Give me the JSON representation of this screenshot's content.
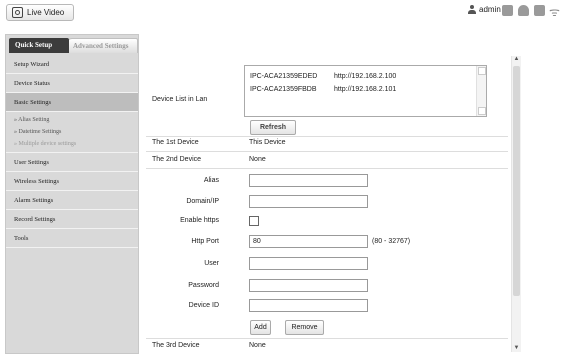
{
  "header": {
    "live_video_label": "Live Video",
    "username": "admin",
    "icons": [
      "person-icon",
      "monitor-icon",
      "headset-icon",
      "speaker-icon",
      "wifi-icon"
    ]
  },
  "sidebar": {
    "tabs": {
      "quick": "Quick Setup",
      "advanced": "Advanced Settings"
    },
    "items": [
      {
        "label": "Setup Wizard"
      },
      {
        "label": "Device Status"
      },
      {
        "label": "Basic Settings"
      },
      {
        "label": "User Settings"
      },
      {
        "label": "Wireless Settings"
      },
      {
        "label": "Alarm Settings"
      },
      {
        "label": "Record Settings"
      },
      {
        "label": "Tools"
      }
    ],
    "subitems": [
      {
        "label": "» Alias Setting"
      },
      {
        "label": "» Datetime Settings"
      },
      {
        "label": "» Multiple device settings"
      }
    ]
  },
  "main": {
    "device_list_label": "Device List in Lan",
    "device_list": [
      {
        "name": "IPC-ACA21359EDED",
        "url": "http://192.168.2.100"
      },
      {
        "name": "IPC-ACA21359FBDB",
        "url": "http://192.168.2.101"
      }
    ],
    "refresh_label": "Refresh",
    "first_device_label": "The 1st Device",
    "first_device_value": "This Device",
    "second_device_label": "The 2nd Device",
    "second_device_value": "None",
    "fields": {
      "alias_label": "Alias",
      "domain_label": "Domain/IP",
      "https_label": "Enable https",
      "port_label": "Http Port",
      "port_value": "80",
      "port_range": "(80 - 32767)",
      "user_label": "User",
      "password_label": "Password",
      "device_id_label": "Device ID"
    },
    "add_label": "Add",
    "remove_label": "Remove",
    "third_device_label": "The 3rd Device",
    "third_device_value": "None"
  },
  "colors": {
    "active_tab": "#3c3c3c",
    "sidebar_bg": "#d9d9d9",
    "active_item": "#bdbdbd"
  }
}
